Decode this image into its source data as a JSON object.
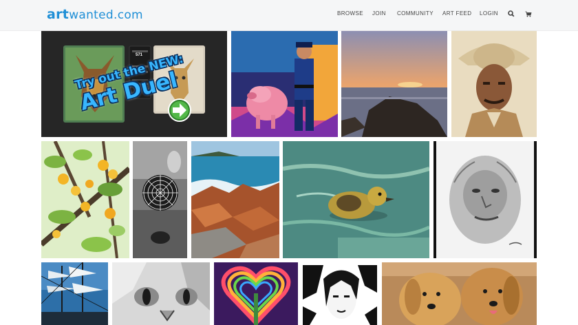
{
  "brand": {
    "logo_bold": "art",
    "logo_rest": "wanted.com",
    "color": "#1f8fd6"
  },
  "nav": {
    "items": [
      {
        "label": "BROWSE"
      },
      {
        "label": "JOIN"
      },
      {
        "label": "COMMUNITY"
      },
      {
        "label": "ART FEED"
      },
      {
        "label": "LOGIN"
      }
    ],
    "search_icon": "search-icon",
    "cart_icon": "cart-icon"
  },
  "promo": {
    "line1": "Try out the NEW:",
    "line2": "Art Duel",
    "vote_count": "571"
  },
  "gallery": {
    "artworks": [
      "pig-police-officer-painting",
      "coastal-sunset-painting",
      "cowboy-portrait-painting",
      "lemon-tree-photo",
      "spiderweb-bw-photo",
      "rocky-shore-photo",
      "duckling-painting",
      "bigfoot-pencil-drawing",
      "tall-ship-photo",
      "cat-eye-drawing",
      "rainbow-heart-tree-art",
      "woman-portrait-ink",
      "golden-retrievers-painting"
    ]
  }
}
